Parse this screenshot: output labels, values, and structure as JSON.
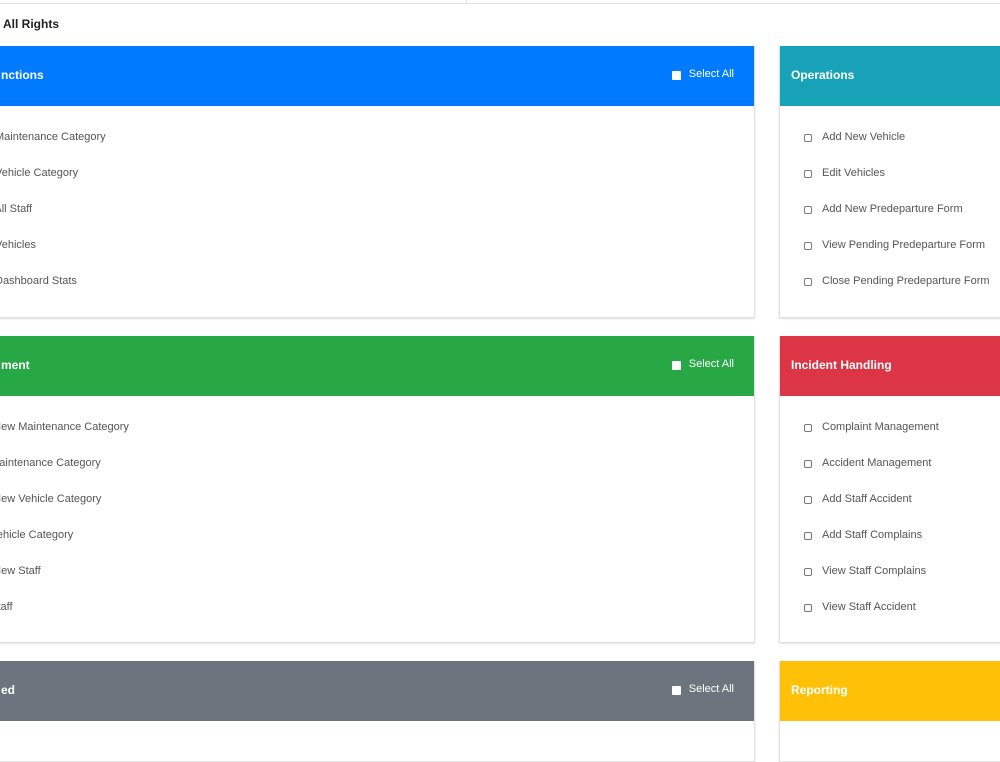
{
  "page": {
    "heading": "All Rights"
  },
  "left_cards": [
    {
      "title": "nctions",
      "select_all_label": "Select All",
      "items": [
        "w Maintenance Category",
        "w Vehicle Category",
        "w All Staff",
        "w Vehicles",
        "w Dashboard Stats"
      ]
    },
    {
      "title": "ment",
      "select_all_label": "Select All",
      "items": [
        "d New Maintenance Category",
        "t Maintenance Category",
        "d New Vehicle Category",
        "t Vehicle Category",
        "d New Staff",
        "t Staff"
      ]
    },
    {
      "title": "ed",
      "select_all_label": "Select All",
      "items": []
    }
  ],
  "right_cards": [
    {
      "title": "Operations",
      "items": [
        "Add New Vehicle",
        "Edit Vehicles",
        "Add New Predeparture Form",
        "View Pending Predeparture Form",
        "Close Pending Predeparture Form"
      ]
    },
    {
      "title": "Incident Handling",
      "items": [
        "Complaint Management",
        "Accident Management",
        "Add Staff Accident",
        "Add Staff Complains",
        "View Staff Complains",
        "View Staff Accident"
      ]
    },
    {
      "title": "Reporting",
      "items": []
    }
  ],
  "colors": {
    "blue": "#007bff",
    "green": "#28a745",
    "gray": "#6c757d",
    "teal": "#17a2b8",
    "red": "#dc3545",
    "yellow": "#ffc107"
  }
}
